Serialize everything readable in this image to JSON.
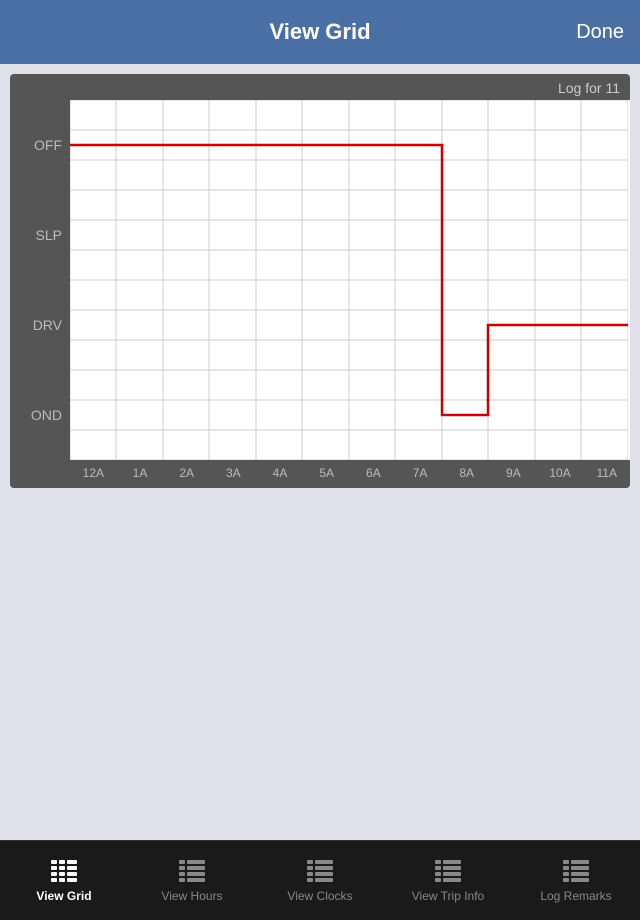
{
  "header": {
    "title": "View Grid",
    "done_label": "Done"
  },
  "chart": {
    "log_label": "Log for 11",
    "y_labels": [
      "OFF",
      "SLP",
      "DRV",
      "OND"
    ],
    "x_labels": [
      "12A",
      "1A",
      "2A",
      "3A",
      "4A",
      "5A",
      "6A",
      "7A",
      "8A",
      "9A",
      "10A",
      "11A"
    ]
  },
  "tabbar": {
    "tabs": [
      {
        "id": "view-grid",
        "label": "View Grid",
        "active": true
      },
      {
        "id": "view-hours",
        "label": "View Hours",
        "active": false
      },
      {
        "id": "view-clocks",
        "label": "View Clocks",
        "active": false
      },
      {
        "id": "view-trip-info",
        "label": "View Trip Info",
        "active": false
      },
      {
        "id": "log-remarks",
        "label": "Log Remarks",
        "active": false
      }
    ]
  }
}
